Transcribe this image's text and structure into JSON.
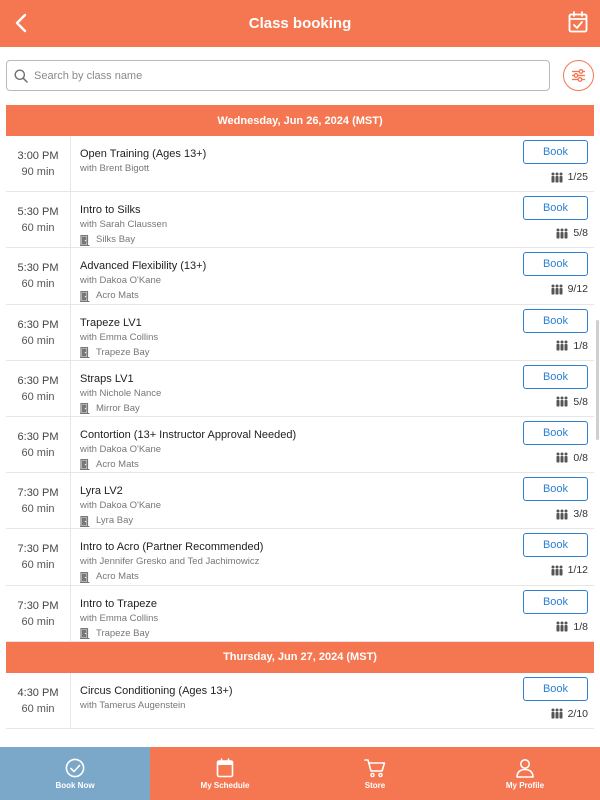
{
  "header": {
    "title": "Class booking"
  },
  "search": {
    "placeholder": "Search by class name"
  },
  "days": [
    {
      "date": "Wednesday, Jun 26, 2024 (MST)",
      "classes": [
        {
          "time": "3:00  PM",
          "duration": "90 min",
          "name": "Open Training (Ages 13+)",
          "instructor": "with Brent Bigott",
          "room": "",
          "book": "Book",
          "capacity": "1/25"
        },
        {
          "time": "5:30  PM",
          "duration": "60 min",
          "name": "Intro to Silks",
          "instructor": "with Sarah Claussen",
          "room": "Silks Bay",
          "book": "Book",
          "capacity": "5/8"
        },
        {
          "time": "5:30  PM",
          "duration": "60 min",
          "name": "Advanced Flexibility (13+)",
          "instructor": "with Dakoa O'Kane",
          "room": "Acro Mats",
          "book": "Book",
          "capacity": "9/12"
        },
        {
          "time": "6:30  PM",
          "duration": "60 min",
          "name": "Trapeze LV1",
          "instructor": "with Emma Collins",
          "room": "Trapeze Bay",
          "book": "Book",
          "capacity": "1/8"
        },
        {
          "time": "6:30  PM",
          "duration": "60 min",
          "name": "Straps LV1",
          "instructor": "with Nichole Nance",
          "room": "Mirror Bay",
          "book": "Book",
          "capacity": "5/8"
        },
        {
          "time": "6:30  PM",
          "duration": "60 min",
          "name": "Contortion (13+ Instructor Approval Needed)",
          "instructor": "with Dakoa O'Kane",
          "room": "Acro Mats",
          "book": "Book",
          "capacity": "0/8"
        },
        {
          "time": "7:30  PM",
          "duration": "60 min",
          "name": "Lyra LV2",
          "instructor": "with Dakoa O'Kane",
          "room": "Lyra Bay",
          "book": "Book",
          "capacity": "3/8"
        },
        {
          "time": "7:30  PM",
          "duration": "60 min",
          "name": "Intro to Acro (Partner Recommended)",
          "instructor": "with Jennifer Gresko and Ted Jachimowicz",
          "room": "Acro Mats",
          "book": "Book",
          "capacity": "1/12"
        },
        {
          "time": "7:30  PM",
          "duration": "60 min",
          "name": "Intro to Trapeze",
          "instructor": "with Emma Collins",
          "room": "Trapeze Bay",
          "book": "Book",
          "capacity": "1/8"
        }
      ]
    },
    {
      "date": "Thursday, Jun 27, 2024 (MST)",
      "classes": [
        {
          "time": "4:30  PM",
          "duration": "60 min",
          "name": "Circus Conditioning (Ages 13+)",
          "instructor": "with Tamerus Augenstein",
          "room": "",
          "book": "Book",
          "capacity": "2/10"
        }
      ]
    }
  ],
  "nav": [
    {
      "label": "Book Now",
      "icon": "check-circle-icon",
      "active": true
    },
    {
      "label": "My Schedule",
      "icon": "calendar-icon",
      "active": false
    },
    {
      "label": "Store",
      "icon": "cart-icon",
      "active": false
    },
    {
      "label": "My Profile",
      "icon": "user-icon",
      "active": false
    }
  ],
  "colors": {
    "brand": "#f47752",
    "book_blue": "#2c7fd1",
    "active_tab": "#7ba7c9"
  }
}
